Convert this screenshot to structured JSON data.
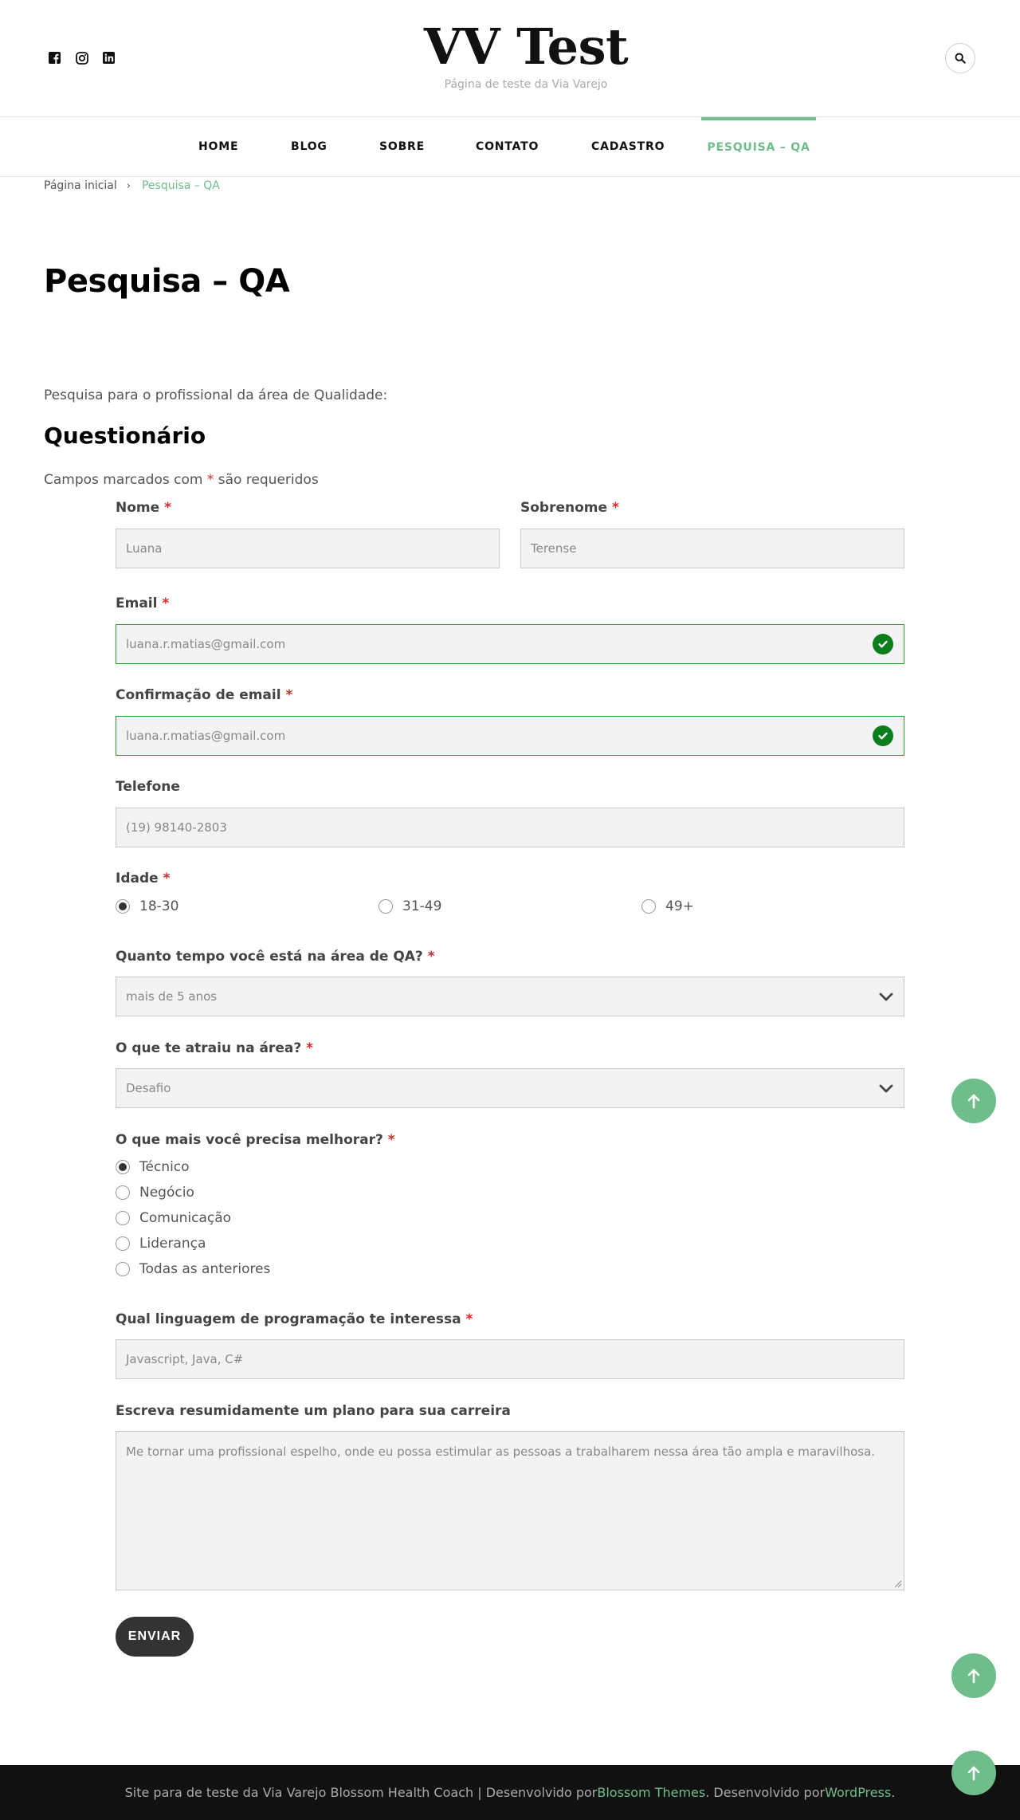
{
  "header": {
    "title": "VV Test",
    "tagline": "Página de teste da Via Varejo",
    "social": [
      "facebook-icon",
      "instagram-icon",
      "linkedin-icon"
    ]
  },
  "nav": {
    "items": [
      {
        "label": "HOME"
      },
      {
        "label": "BLOG"
      },
      {
        "label": "SOBRE"
      },
      {
        "label": "CONTATO"
      },
      {
        "label": "CADASTRO"
      },
      {
        "label": "PESQUISA – QA",
        "active": true
      }
    ]
  },
  "breadcrumb": {
    "home": "Página inicial",
    "separator": "›",
    "current": "Pesquisa – QA"
  },
  "page": {
    "title": "Pesquisa – QA",
    "intro": "Pesquisa para o profissional da área de Qualidade:",
    "section_title": "Questionário",
    "required_note_pre": "Campos marcados com ",
    "required_star": "*",
    "required_note_post": " são requeridos"
  },
  "form": {
    "nome": {
      "label": "Nome",
      "value": "Luana"
    },
    "sobrenome": {
      "label": "Sobrenome",
      "value": "Terense"
    },
    "email": {
      "label": "Email",
      "value": "luana.r.matias@gmail.com"
    },
    "email_confirm": {
      "label": "Confirmação de email",
      "value": "luana.r.matias@gmail.com"
    },
    "telefone": {
      "label": "Telefone",
      "value": "(19) 98140-2803"
    },
    "idade": {
      "label": "Idade",
      "options": [
        "18-30",
        "31-49",
        "49+"
      ],
      "selected": "18-30"
    },
    "tempo_qa": {
      "label": "Quanto tempo você está na área de QA?",
      "value": "mais de 5 anos"
    },
    "atraiu": {
      "label": "O que te atraiu na área?",
      "value": "Desafio"
    },
    "melhorar": {
      "label": "O que mais você precisa melhorar?",
      "options": [
        "Técnico",
        "Negócio",
        "Comunicação",
        "Liderança",
        "Todas as anteriores"
      ],
      "selected": "Técnico"
    },
    "linguagem": {
      "label": "Qual linguagem de programação te interessa",
      "value": "Javascript, Java, C#"
    },
    "plano": {
      "label": "Escreva resumidamente um plano para sua carreira",
      "value": "Me tornar uma profissional espelho, onde eu possa estimular as pessoas a trabalharem nessa área tão ampla e maravilhosa."
    },
    "submit_label": "ENVIAR"
  },
  "footer": {
    "text_pre": "Site para de teste da Via Varejo Blossom Health Coach | Desenvolvido por ",
    "link1": "Blossom Themes",
    "text_mid": ". Desenvolvido por ",
    "link2": "WordPress",
    "text_post": "."
  },
  "colors": {
    "accent": "#6ebd8a",
    "required": "#d72b2b",
    "valid": "#0a7d1c",
    "footer_bg": "#111111"
  }
}
